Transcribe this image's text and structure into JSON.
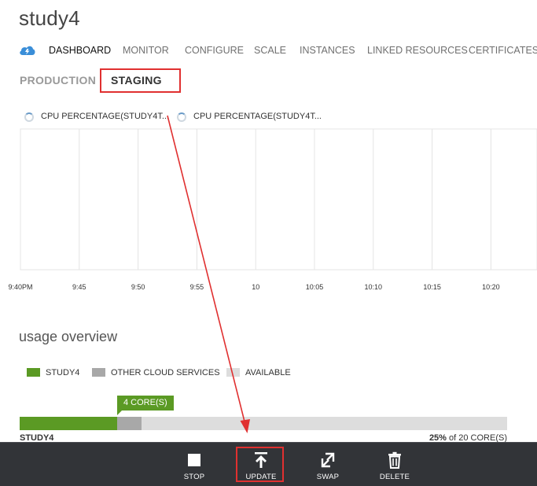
{
  "service_name": "study4",
  "nav_tabs": [
    "DASHBOARD",
    "MONITOR",
    "CONFIGURE",
    "SCALE",
    "INSTANCES",
    "LINKED RESOURCES",
    "CERTIFICATES"
  ],
  "env_tabs": {
    "production": "PRODUCTION",
    "staging": "STAGING"
  },
  "metrics_legend": [
    "CPU PERCENTAGE(STUDY4T...",
    "CPU PERCENTAGE(STUDY4T..."
  ],
  "chart_data": {
    "type": "line",
    "x": [
      "9:40PM",
      "9:45",
      "9:50",
      "9:55",
      "10",
      "10:05",
      "10:10",
      "10:15",
      "10:20"
    ],
    "series": [
      {
        "name": "CPU PERCENTAGE(STUDY4T...",
        "values": []
      },
      {
        "name": "CPU PERCENTAGE(STUDY4T...",
        "values": []
      }
    ],
    "grid": true
  },
  "usage": {
    "title": "usage overview",
    "legend": [
      {
        "label": "STUDY4",
        "color": "#5b9a24"
      },
      {
        "label": "OTHER CLOUD SERVICES",
        "color": "#a8a8a8"
      },
      {
        "label": "AVAILABLE",
        "color": "#dddddd"
      }
    ],
    "core_tag": "4 CORE(S)",
    "self_fraction": 0.2,
    "other_fraction": 0.05,
    "bar_label": "STUDY4",
    "usage_percent": "25%",
    "usage_of": "of 20 CORE(S)"
  },
  "commands": [
    "STOP",
    "UPDATE",
    "SWAP",
    "DELETE"
  ]
}
